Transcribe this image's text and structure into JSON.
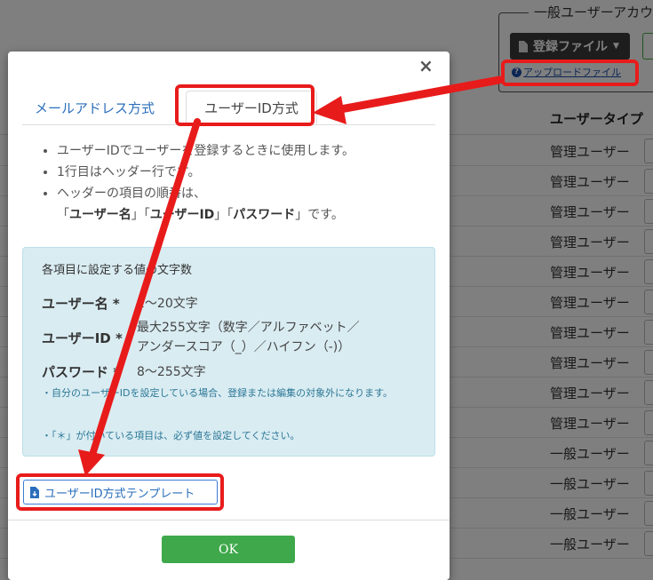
{
  "background": {
    "fieldset_legend": "一般ユーザーアカウ",
    "register_button_label": "登録ファイル",
    "upload_link_label": "アップロードファイル",
    "table_header_user_type": "ユーザータイプ",
    "rows": [
      "管理ユーザー",
      "管理ユーザー",
      "管理ユーザー",
      "管理ユーザー",
      "管理ユーザー",
      "管理ユーザー",
      "管理ユーザー",
      "管理ユーザー",
      "管理ユーザー",
      "管理ユーザー",
      "一般ユーザー",
      "一般ユーザー",
      "一般ユーザー",
      "一般ユーザー"
    ]
  },
  "modal": {
    "close_label": "×",
    "tabs": [
      {
        "label": "メールアドレス方式",
        "active": false
      },
      {
        "label": "ユーザーID方式",
        "active": true
      }
    ],
    "bullets": {
      "b1": "ユーザーIDでユーザーを登録するときに使用します。",
      "b2": "1行目はヘッダー行です。",
      "b3": "ヘッダーの項目の順番は、",
      "b3_line2": {
        "q1": "「",
        "f1": "ユーザー名",
        "q2": "」「",
        "f2": "ユーザーID",
        "q3": "」「",
        "f3": "パスワード",
        "q4": "」です。"
      }
    },
    "info": {
      "title": "各項目に設定する値の文字数",
      "fields": [
        {
          "label": "ユーザー名 *",
          "value": "1〜20文字"
        },
        {
          "label": "ユーザーID *",
          "value": "最大255文字（数字／アルファベット／",
          "value2": "アンダースコア（_）／ハイフン（-)）"
        },
        {
          "label": "パスワード *",
          "value": "8〜255文字"
        }
      ],
      "note1": "・自分のユーザーIDを設定している場合、登録または編集の対象外になります。",
      "note2": "・「＊」が付いている項目は、必ず値を設定してください。"
    },
    "template_button_label": "ユーザーID方式テンプレート",
    "ok_label": "OK"
  },
  "colors": {
    "highlight": "#e81b1b",
    "link_blue": "#2a6ebb",
    "ok_green": "#3ea84b",
    "info_bg": "#d9ecf2"
  }
}
